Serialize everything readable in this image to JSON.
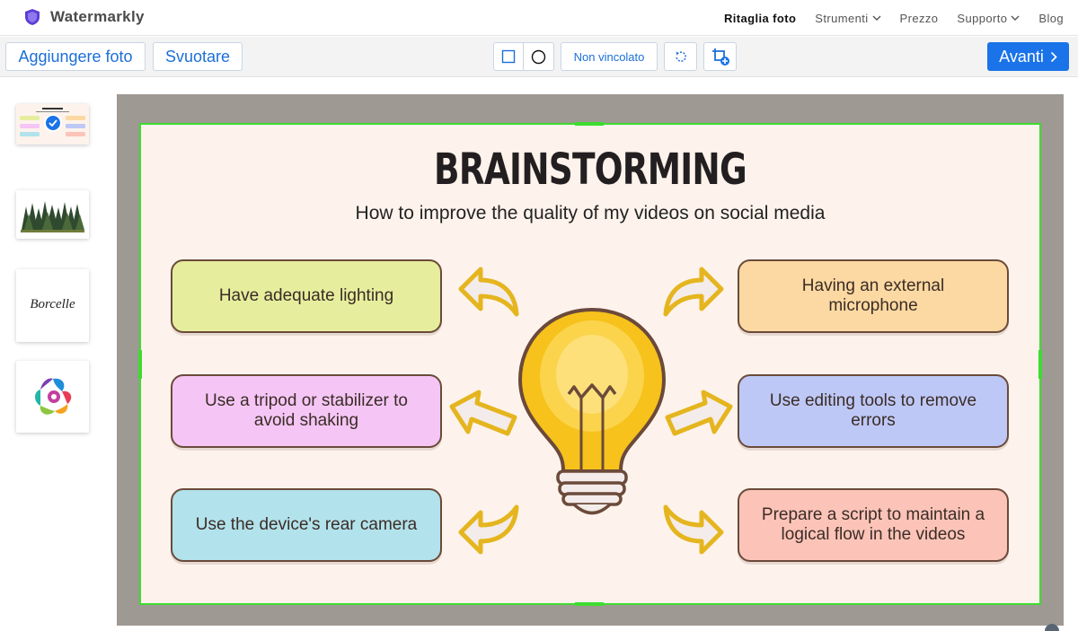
{
  "app": {
    "name": "Watermarkly"
  },
  "nav": {
    "items": [
      {
        "label": "Ritaglia foto",
        "active": true,
        "dropdown": false
      },
      {
        "label": "Strumenti",
        "active": false,
        "dropdown": true
      },
      {
        "label": "Prezzo",
        "active": false,
        "dropdown": false
      },
      {
        "label": "Supporto",
        "active": false,
        "dropdown": true
      },
      {
        "label": "Blog",
        "active": false,
        "dropdown": false
      }
    ]
  },
  "toolbar": {
    "add_label": "Aggiungere foto",
    "clear_label": "Svuotare",
    "ratio_label": "Non vincolato",
    "next_label": "Avanti"
  },
  "colors": {
    "accent": "#1a73e8",
    "crop_border": "#3ddc2f",
    "canvas_background": "#9f9993"
  },
  "sidebar": {
    "thumbnails": [
      {
        "icon": "brainstorming-thumbnail",
        "selected": true
      },
      {
        "icon": "forest-thumbnail",
        "selected": false
      },
      {
        "icon": "borcelle-logo-thumbnail",
        "selected": false,
        "text": "Borcelle"
      },
      {
        "icon": "colorful-swirl-thumbnail",
        "selected": false
      }
    ]
  },
  "image": {
    "title": "BRAINSTORMING",
    "subtitle": "How to improve the quality of my videos on social media",
    "cards": [
      "Have adequate lighting",
      "Use a tripod or stabilizer to avoid shaking",
      "Use the device's rear camera",
      "Having an external microphone",
      "Use editing tools to remove errors",
      "Prepare a script to maintain a logical flow in the videos"
    ]
  }
}
